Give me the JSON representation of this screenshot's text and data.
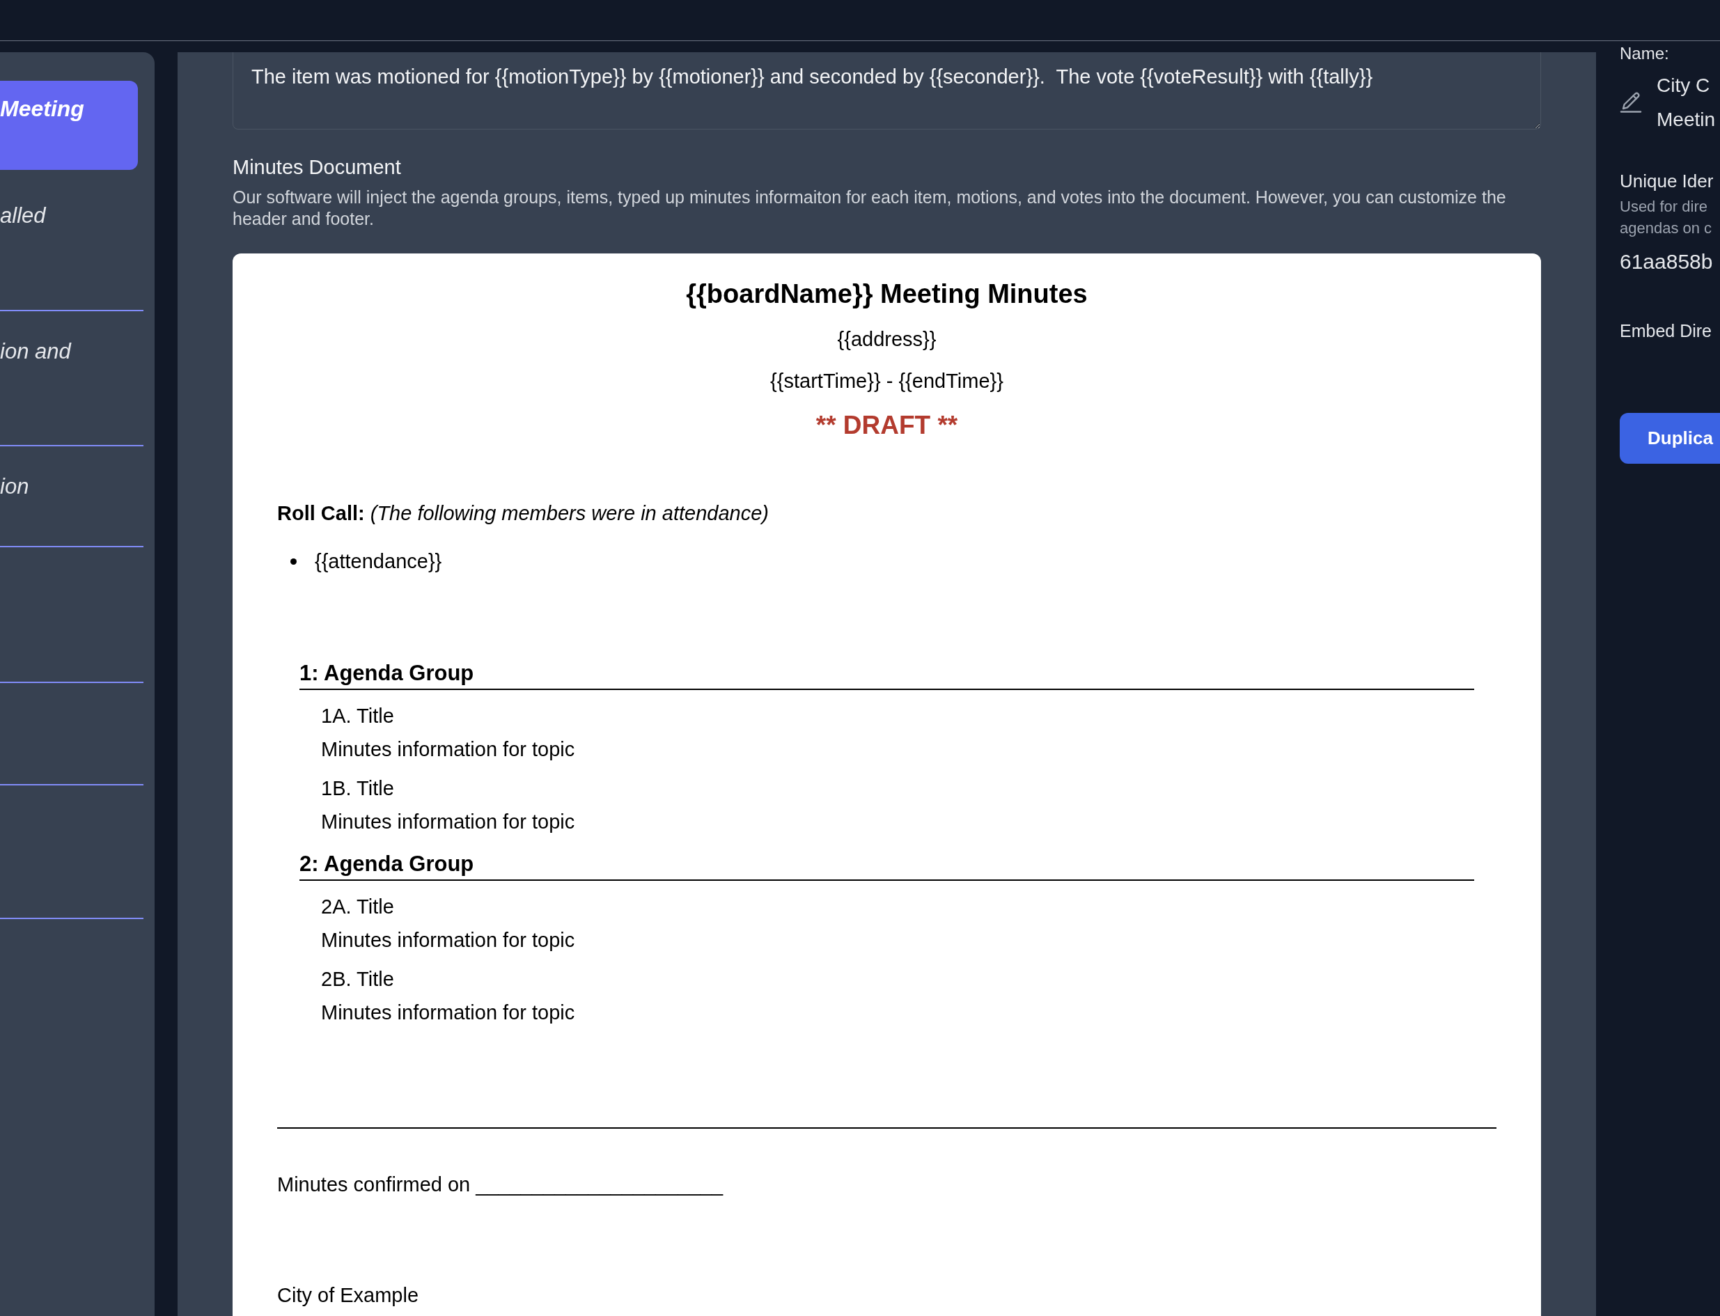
{
  "sidebar": {
    "items": [
      {
        "label": "Meeting",
        "selected": true
      },
      {
        "label": "alled",
        "selected": false
      },
      {
        "label": "ion and",
        "selected": false
      },
      {
        "label": "ion",
        "selected": false
      },
      {
        "selected": false
      },
      {
        "selected": false
      },
      {
        "selected": false
      }
    ]
  },
  "editor": {
    "template_text": "The item was motioned for {{motionType}} by {{motioner}} and seconded by {{seconder}}.  The vote {{voteResult}} with {{tally}}",
    "section_label": "Minutes Document",
    "section_description": "Our software will inject the agenda groups, items, typed up minutes informaiton for each item, motions, and votes into the document. However, you can customize the header and footer."
  },
  "document": {
    "title": "{{boardName}} Meeting Minutes",
    "address": "{{address}}",
    "time_range": "{{startTime}} - {{endTime}}",
    "draft_mark": "** DRAFT **",
    "roll_call": "**Roll Call:** *(The following members were in attendance)*",
    "attendance": [
      "{{attendance}}"
    ],
    "agenda_groups": [
      {
        "heading": "1: Agenda Group",
        "items": [
          {
            "title": "1A. Title",
            "minutes": "Minutes information for topic"
          },
          {
            "title": "1B. Title",
            "minutes": "Minutes information for topic"
          }
        ]
      },
      {
        "heading": "2: Agenda Group",
        "items": [
          {
            "title": "2A. Title",
            "minutes": "Minutes information for topic"
          },
          {
            "title": "2B. Title",
            "minutes": "Minutes information for topic"
          }
        ]
      }
    ],
    "confirmation": "Minutes confirmed on ______________________",
    "footer": "City of Example"
  },
  "details": {
    "name_label": "Name:",
    "name_lines": [
      "City C",
      "Meetin"
    ],
    "identifier_label": "Unique Ider",
    "identifier_hint_lines": [
      "Used for dire",
      "agendas on c"
    ],
    "identifier": "61aa858b",
    "embed_label": "Embed Dire",
    "duplicate_button": "Duplica"
  }
}
